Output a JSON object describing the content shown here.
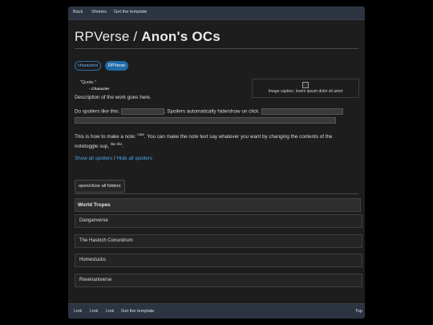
{
  "nav": {
    "back": "Back",
    "shrines": "Shrines",
    "template": "Get the template"
  },
  "title": {
    "prefix": "RPVerse /",
    "name": "Anon's OCs"
  },
  "tags": [
    "characters",
    "RPVerse"
  ],
  "quote": {
    "text": "\"Quote.\"",
    "attribution": "- Character"
  },
  "figure": {
    "caption": "Image caption, lorem ipsum dolor sit amet"
  },
  "body": {
    "description": "Description of the work goes here.",
    "spoiler_intro": "Do spoilers like this:",
    "spoiler_mid": ". Spoilers automatically hide/show on click.",
    "note_intro": "This is how to make a note:",
    "note_sup": "note",
    "note_rest": ". You can make the note text say whatever you want by changing the contents of the",
    "note_line2": "notetoggle sup,",
    "note_sup2": "like this",
    "note_end": ".",
    "show_all": "Show all spoilers",
    "separator": " / ",
    "hide_all": "Hide all spoilers"
  },
  "folders_button": "open/close all folders",
  "section": {
    "title": "World Tropes",
    "items": [
      "Danganverse",
      "The Hasloch Conundrum",
      "Homestucks",
      "Revenantverse"
    ]
  },
  "footer": {
    "link1": "Link",
    "link2": "Link",
    "link3": "Link",
    "template": "Get the template",
    "top": "Top"
  }
}
